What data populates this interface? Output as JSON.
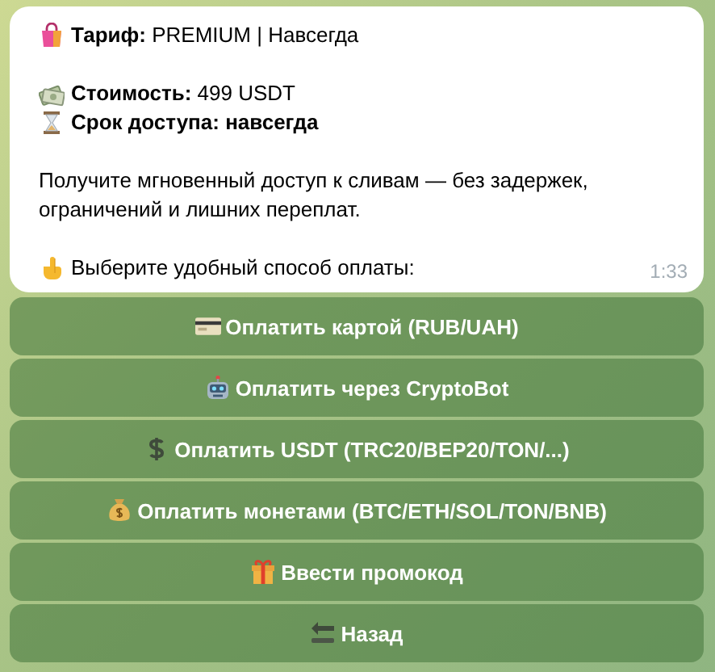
{
  "message": {
    "blocks": [
      [
        {
          "text": "**Тариф:** PREMIUM | Навсегда",
          "bold": false
        }
      ],
      [
        {
          "text": "**Стоимость:** 499 USDT",
          "bold": false
        },
        {
          "text": "Срок доступа: навсегда",
          "bold": true
        }
      ]
    ],
    "paragraph": "Получите мгновенный доступ к сливам — без задержек, ограничений и лишних переплат.",
    "prompt": "Выберите удобный способ оплаты:",
    "time": "1:33"
  },
  "buttons": [
    {
      "label": "Оплатить картой (RUB/UAH)"
    },
    {
      "label": "Оплатить через CryptoBot"
    },
    {
      "label": "Оплатить USDT (TRC20/BEP20/TON/...)"
    },
    {
      "label": "Оплатить монетами (BTC/ETH/SOL/TON/BNB)"
    },
    {
      "label": "Ввести промокод"
    },
    {
      "label": "Назад"
    }
  ]
}
